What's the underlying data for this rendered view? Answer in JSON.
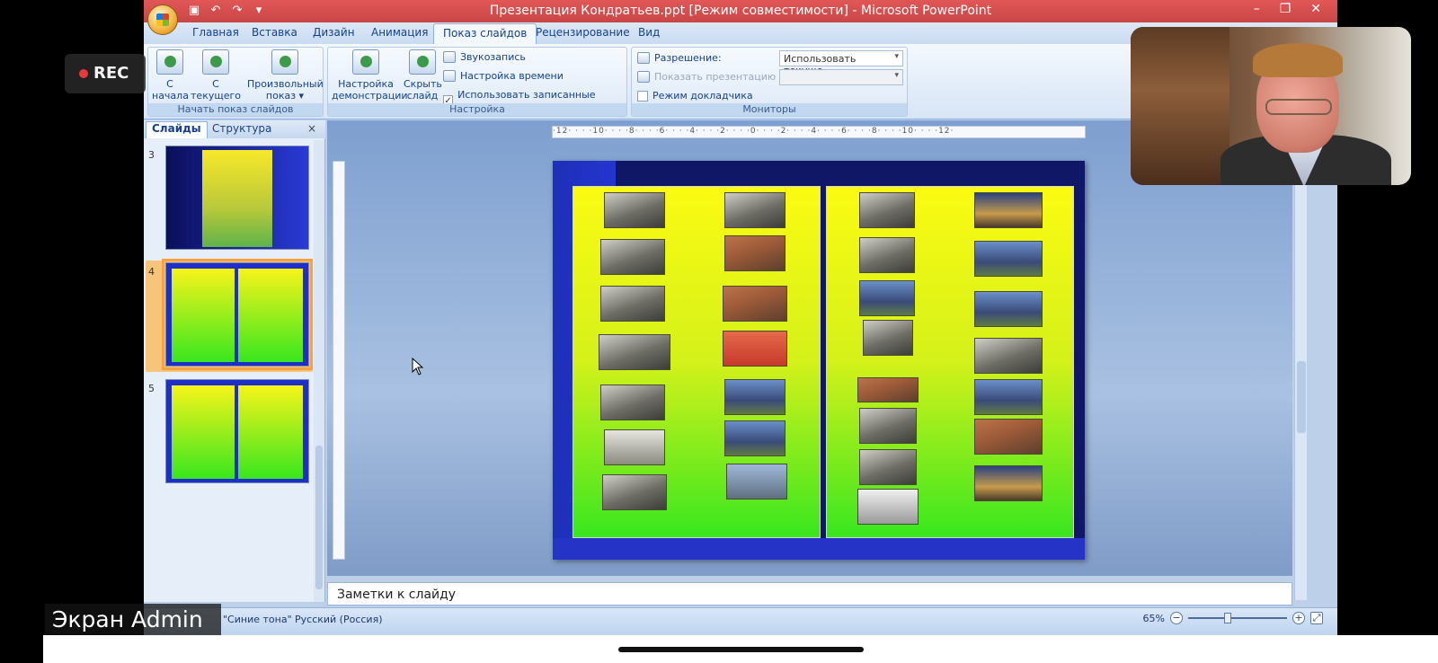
{
  "window": {
    "title": "Презентация Кондратьев.ppt [Режим совместимости] - Microsoft PowerPoint",
    "controls": [
      "–",
      "❐",
      "✕"
    ]
  },
  "ribbon_tabs": [
    "Главная",
    "Вставка",
    "Дизайн",
    "Анимация",
    "Показ слайдов",
    "Рецензирование",
    "Вид"
  ],
  "active_tab": "Показ слайдов",
  "groups": {
    "start_show": {
      "label": "Начать показ слайдов",
      "from_start": "С\nначала",
      "from_current": "С текущего\nслайда",
      "custom": "Произвольный\nпоказ"
    },
    "setup": {
      "label": "Настройка",
      "setup_show": "Настройка\nдемонстрации",
      "hide_slide": "Скрыть\nслайд",
      "record_narration": "Звукозапись",
      "rehearse_timings": "Настройка времени",
      "use_timings": "Использовать записанные времена"
    },
    "monitors": {
      "label": "Мониторы",
      "resolution_label": "Разрешение:",
      "resolution_value": "Использовать текуще...",
      "show_on_label": "Показать презентацию на:",
      "show_on_value": "",
      "presenter_view": "Режим докладчика"
    }
  },
  "left_panel": {
    "tab_slides": "Слайды",
    "tab_outline": "Структура",
    "close": "×",
    "thumb_numbers": [
      "3",
      "4",
      "5"
    ]
  },
  "ruler_text": "·12· · · ·10· · · ·8· · · ·6· · · ·4· · · ·2· · · ·0· · · ·2· · · ·4· · · ·6· · · ·8· · · ·10· · · ·12·",
  "notes_placeholder": "Заметки к слайду",
  "status": {
    "theme": "\"Синие тона\"",
    "language": "Русский (Россия)",
    "zoom": "65%"
  },
  "overlays": {
    "rec": "REC",
    "screen_label": "Экран Admin"
  },
  "colors": {
    "title_bar": "#c94646",
    "rec_dot": "#e53b3b",
    "slide_bg": "#101766"
  }
}
